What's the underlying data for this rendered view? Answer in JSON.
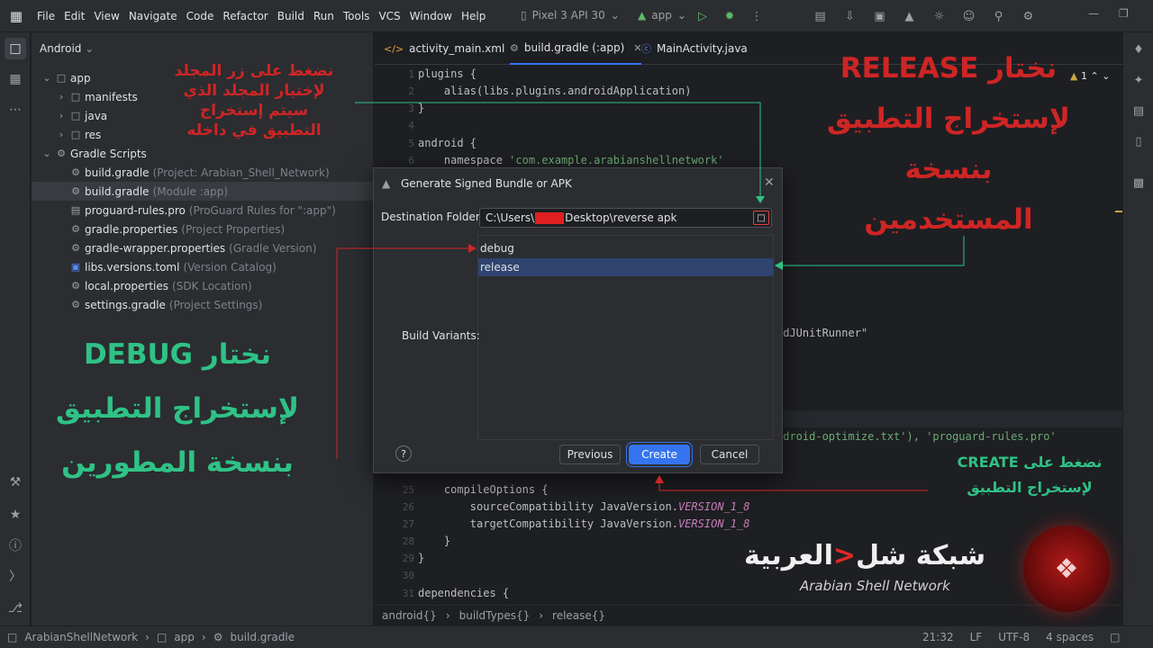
{
  "menubar": {
    "items": [
      "File",
      "Edit",
      "View",
      "Navigate",
      "Code",
      "Refactor",
      "Build",
      "Run",
      "Tools",
      "VCS",
      "Window",
      "Help"
    ],
    "device": "Pixel 3 API 30",
    "run_config": "app"
  },
  "project": {
    "header": "Android",
    "tree": [
      {
        "label": "app",
        "note": ""
      },
      {
        "label": "manifests",
        "note": ""
      },
      {
        "label": "java",
        "note": ""
      },
      {
        "label": "res",
        "note": ""
      },
      {
        "label": "Gradle Scripts",
        "note": ""
      },
      {
        "label": "build.gradle",
        "note": "(Project: Arabian_Shell_Network)"
      },
      {
        "label": "build.gradle",
        "note": "(Module :app)"
      },
      {
        "label": "proguard-rules.pro",
        "note": "(ProGuard Rules for \":app\")"
      },
      {
        "label": "gradle.properties",
        "note": "(Project Properties)"
      },
      {
        "label": "gradle-wrapper.properties",
        "note": "(Gradle Version)"
      },
      {
        "label": "libs.versions.toml",
        "note": "(Version Catalog)"
      },
      {
        "label": "local.properties",
        "note": "(SDK Location)"
      },
      {
        "label": "settings.gradle",
        "note": "(Project Settings)"
      }
    ]
  },
  "editor": {
    "tabs": [
      "activity_main.xml",
      "build.gradle (:app)",
      "MainActivity.java"
    ],
    "warnings": "1",
    "lines": [
      {
        "n": "1",
        "code": "plugins {"
      },
      {
        "n": "2",
        "code": "    alias(libs.plugins.androidApplication)"
      },
      {
        "n": "3",
        "code": "}"
      },
      {
        "n": "4",
        "code": ""
      },
      {
        "n": "5",
        "code": "android {"
      },
      {
        "n": "6",
        "code": "    namespace ",
        "str": "'com.example.arabianshellnetwork'"
      },
      {
        "n": "25",
        "code": "    compileOptions {"
      },
      {
        "n": "26",
        "code": "        sourceCompatibility JavaVersion.",
        "const": "VERSION_1_8"
      },
      {
        "n": "27",
        "code": "        targetCompatibility JavaVersion.",
        "const": "VERSION_1_8"
      },
      {
        "n": "28",
        "code": "    }"
      },
      {
        "n": "29",
        "code": "}"
      },
      {
        "n": "30",
        "code": ""
      },
      {
        "n": "31",
        "code": "dependencies {"
      }
    ],
    "partial_runner": "idJUnitRunner\"",
    "partial_proguard": "ndroid-optimize.txt'), 'proguard-rules.pro'",
    "breadcrumbs": [
      "android{}",
      "buildTypes{}",
      "release{}"
    ]
  },
  "dialog": {
    "title": "Generate Signed Bundle or APK",
    "dest_label": "Destination Folder:",
    "dest_prefix": "C:\\Users\\",
    "dest_suffix": "Desktop\\reverse apk",
    "variants_label": "Build Variants:",
    "variants": [
      "debug",
      "release"
    ],
    "help": "?",
    "buttons": {
      "previous": "Previous",
      "create": "Create",
      "cancel": "Cancel"
    }
  },
  "statusbar": {
    "project": "ArabianShellNetwork",
    "module": "app",
    "file": "build.gradle",
    "position": "21:32",
    "line_sep": "LF",
    "encoding": "UTF-8",
    "indent": "4 spaces"
  },
  "annotations": {
    "folder_note": [
      "نضغط على زر المجلد",
      "لإختيار المجلد الذي",
      "سيتم إستخراج",
      "التطبيق في داخله"
    ],
    "release_note": [
      "نختار RELEASE",
      "لإستخراج التطبيق",
      "بنسخة",
      "المستخدمين"
    ],
    "debug_note": [
      "نختار DEBUG",
      "لإستخراج التطبيق",
      "بنسخة المطورين"
    ],
    "create_note": [
      "نضغط على CREATE",
      "لإستخراج التطبيق"
    ]
  },
  "watermark": {
    "arabic_part1": "شبكة شل",
    "arabic_mark": "<",
    "arabic_part2": "العربية",
    "english": "Arabian Shell Network"
  },
  "colors": {
    "accent": "#3574f0",
    "annotation_red": "#cf2525",
    "annotation_green": "#2fc286",
    "selected_variant": "#2e436e"
  }
}
